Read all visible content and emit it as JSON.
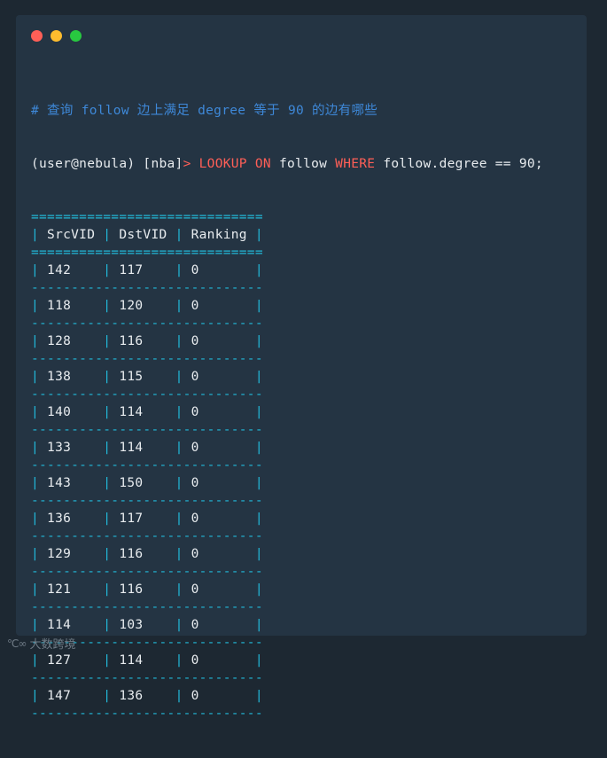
{
  "window": {
    "controls": [
      "close",
      "minimize",
      "maximize"
    ]
  },
  "terminal": {
    "comment": "# 查询 follow 边上满足 degree 等于 90 的边有哪些",
    "prompt": "(user@nebula) [nba]",
    "prompt_arrow": ">",
    "command": {
      "kw1": "LOOKUP",
      "kw2": "ON",
      "edge": "follow",
      "kw3": "WHERE",
      "condition": "follow.degree == 90;"
    },
    "table": {
      "border_double": "=============================",
      "border_dashed": "-----------------------------",
      "headers": [
        "SrcVID",
        "DstVID",
        "Ranking"
      ],
      "rows": [
        [
          "142",
          "117",
          "0"
        ],
        [
          "118",
          "120",
          "0"
        ],
        [
          "128",
          "116",
          "0"
        ],
        [
          "138",
          "115",
          "0"
        ],
        [
          "140",
          "114",
          "0"
        ],
        [
          "133",
          "114",
          "0"
        ],
        [
          "143",
          "150",
          "0"
        ],
        [
          "136",
          "117",
          "0"
        ],
        [
          "129",
          "116",
          "0"
        ],
        [
          "121",
          "116",
          "0"
        ],
        [
          "114",
          "103",
          "0"
        ],
        [
          "127",
          "114",
          "0"
        ],
        [
          "147",
          "136",
          "0"
        ]
      ]
    }
  },
  "watermark": {
    "logo": "℃∞",
    "text": "大数跨境"
  },
  "colors": {
    "background": "#1d2832",
    "window": "#243443",
    "comment": "#3e88d8",
    "keyword": "#ff5f57",
    "table_border": "#22b8d8",
    "text": "#e8ecef"
  }
}
